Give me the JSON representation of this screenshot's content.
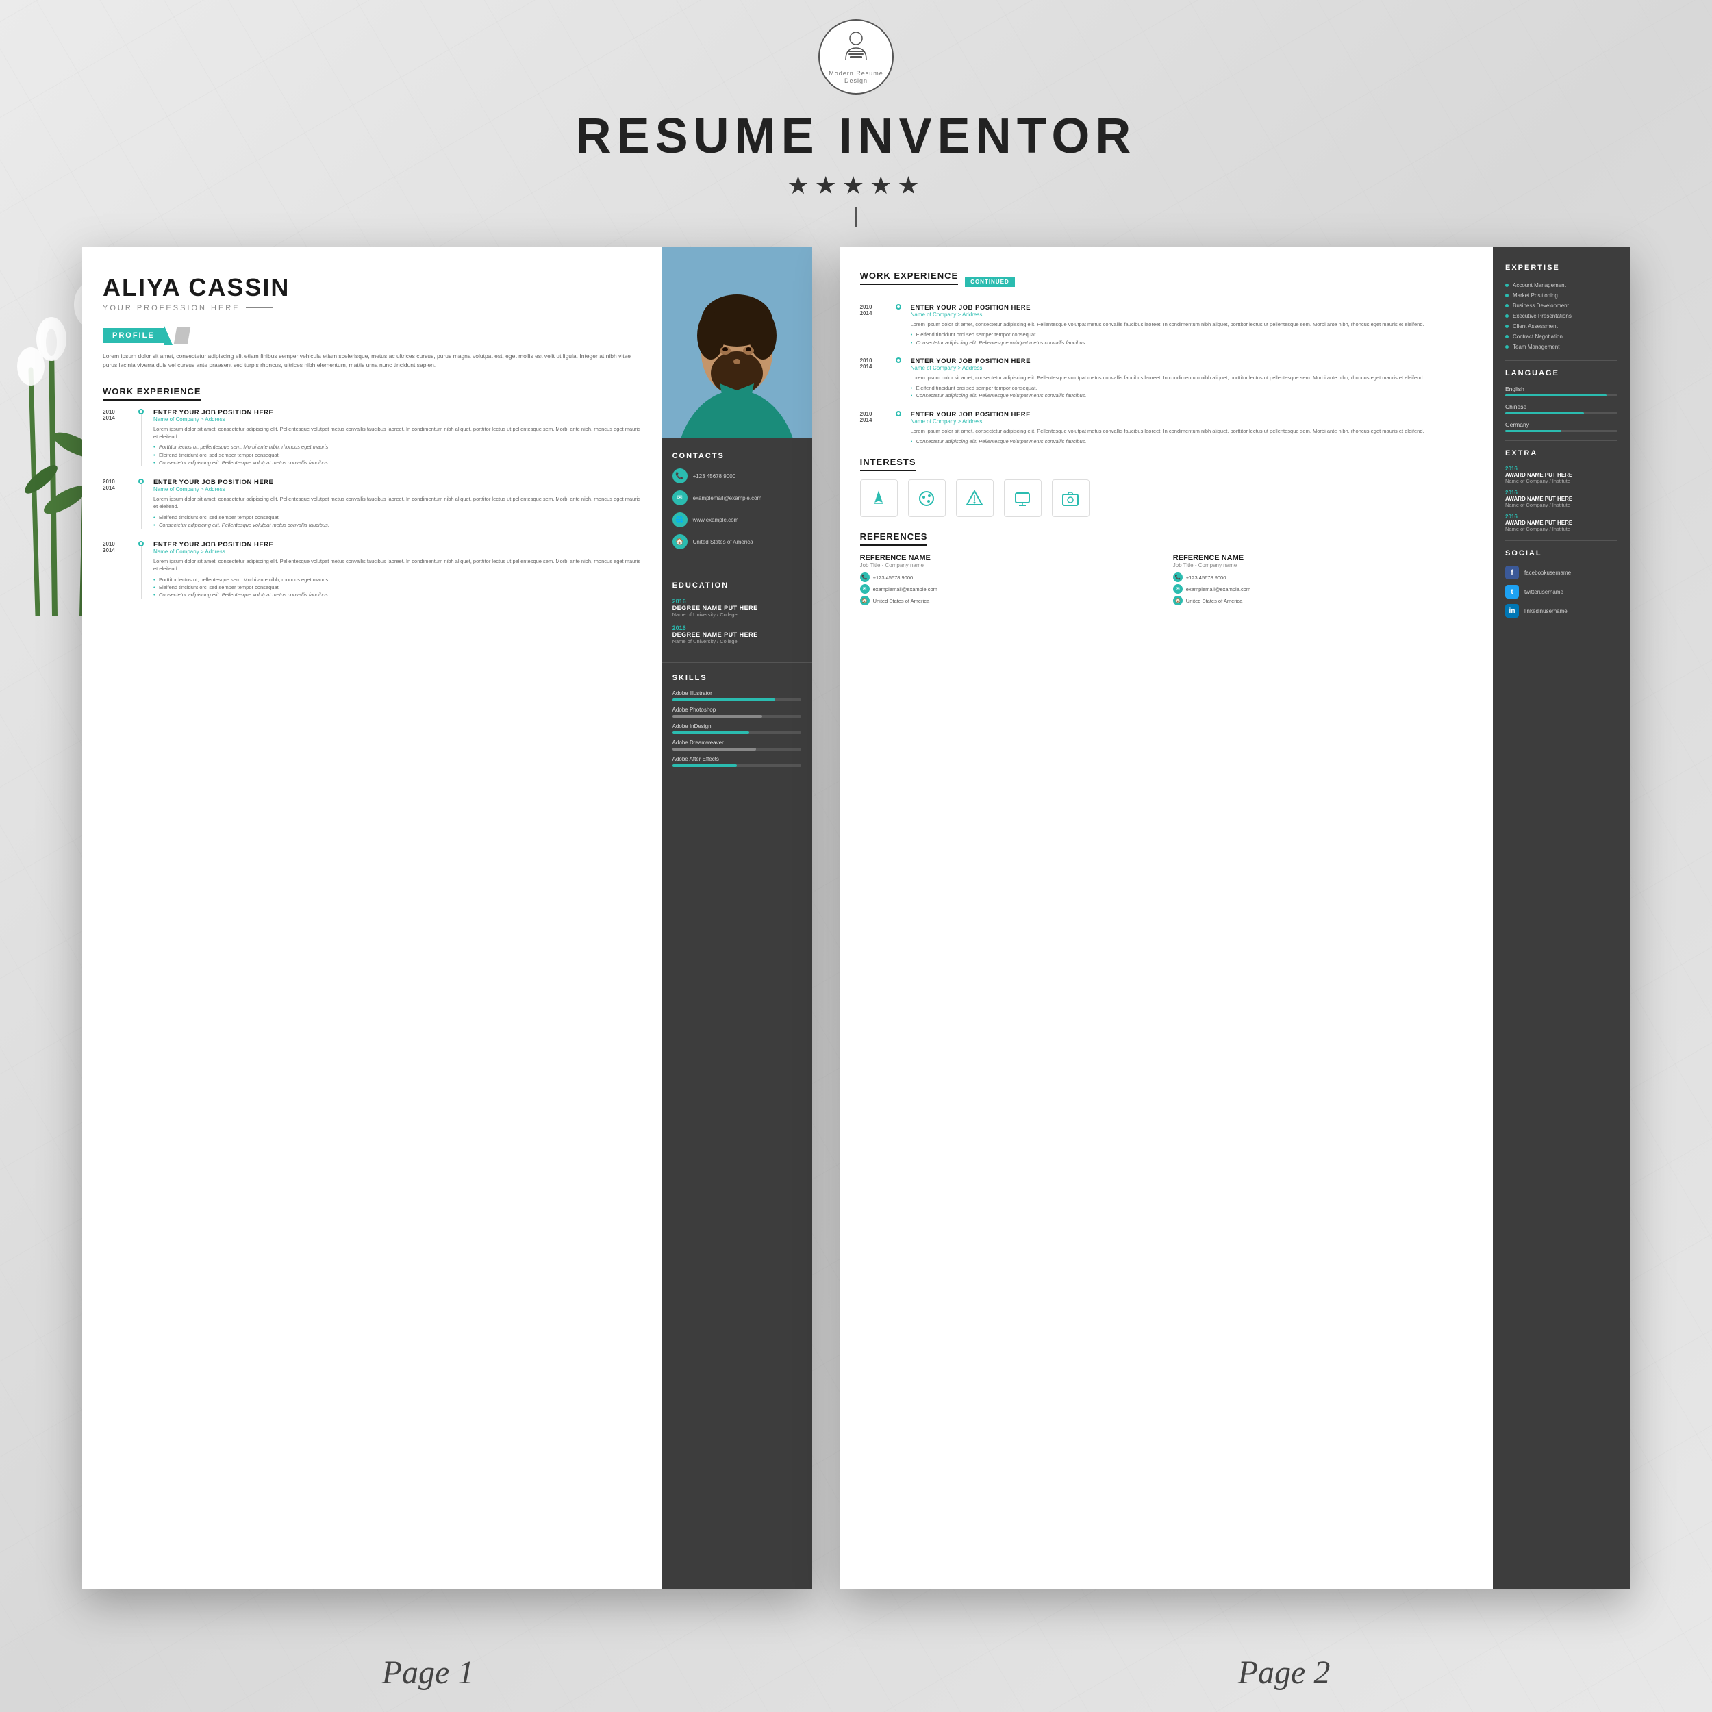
{
  "app": {
    "title": "Resume Inventor",
    "stars": "★★★★★",
    "logo_text": "Modern Resume Design",
    "page1_label": "Page 1",
    "page2_label": "Page 2"
  },
  "resume": {
    "name": "ALIYA CASSIN",
    "profession": "YOUR PROFESSION HERE",
    "profile": {
      "section_title": "PROFILE",
      "text": "Lorem ipsum dolor sit amet, consectetur adipiscing elit etiam finibus semper vehicula etiam scelerisque, metus ac ultrices cursus, purus magna volutpat est, eget mollis est velit ut ligula. Integer at nibh vitae purus lacinia viverra duis vel cursus ante praesent sed turpis rhoncus, ultrices nibh elementum, mattis urna nunc tincidunt sapien."
    },
    "work_experience": {
      "section_title": "WORK EXPERIENCE",
      "entries": [
        {
          "year_start": "2010",
          "year_end": "2014",
          "position": "ENTER YOUR JOB POSITION HERE",
          "company": "Name of Company > Address",
          "desc": "Lorem ipsum dolor sit amet, consectetur adipiscing elit. Pellentesque volutpat metus convallis faucibus laoreet. In condimentum nibh aliquet, porttitor lectus ut pellentesque sem. Morbi ante nibh, rhoncus eget mauris et eleifend.",
          "bullets": [
            "Porttitor lectus ut, pellentesque sem. Morbi ante nibh, rhoncus eget mauris",
            "Eleifend tincidunt orci sed semper tempor consequat.",
            "Consectetur adipiscing elit. Pellentesque volutpat metus convallis faucibus."
          ]
        },
        {
          "year_start": "2010",
          "year_end": "2014",
          "position": "ENTER YOUR JOB POSITION HERE",
          "company": "Name of Company > Address",
          "desc": "Lorem ipsum dolor sit amet, consectetur adipiscing elit. Pellentesque volutpat metus convallis faucibus laoreet. In condimentum nibh aliquet, porttitor lectus ut pellentesque sem. Morbi ante nibh, rhoncus eget mauris et eleifend.",
          "bullets": [
            "Eleifend tincidunt orci sed semper tempor consequat.",
            "Consectetur adipiscing elit. Pellentesque volutpat metus convallis faucibus."
          ]
        },
        {
          "year_start": "2010",
          "year_end": "2014",
          "position": "ENTER YOUR JOB POSITION HERE",
          "company": "Name of Company > Address",
          "desc": "Lorem ipsum dolor sit amet, consectetur adipiscing elit. Pellentesque volutpat metus convallis faucibus laoreet. In condimentum nibh aliquet, porttitor lectus ut pellentesque sem. Morbi ante nibh, rhoncus eget mauris et eleifend.",
          "bullets": [
            "Porttitor lectus ut, pellentesque sem. Morbi ante nibh, rhoncus eget mauris",
            "Eleifend tincidunt orci sed semper tempor consequat.",
            "Consectetur adipiscing elit. Pellentesque volutpat metus convallis faucibus."
          ]
        }
      ]
    },
    "contacts": {
      "section_title": "CONTACTS",
      "phone": "+123 45678 9000",
      "email": "examplemail@example.com",
      "website": "www.example.com",
      "address": "United States of America"
    },
    "education": {
      "section_title": "EDUCATION",
      "entries": [
        {
          "year": "2016",
          "degree": "DEGREE NAME PUT HERE",
          "school": "Name of University / College"
        },
        {
          "year": "2016",
          "degree": "DEGREE NAME PUT HERE",
          "school": "Name of University / College"
        }
      ]
    },
    "skills": {
      "section_title": "SKILLS",
      "items": [
        {
          "name": "Adobe Illustrator",
          "level": 80,
          "type": "teal"
        },
        {
          "name": "Adobe Photoshop",
          "level": 70,
          "type": "light"
        },
        {
          "name": "Adobe InDesign",
          "level": 60,
          "type": "teal"
        },
        {
          "name": "Adobe Dreamweaver",
          "level": 65,
          "type": "light"
        },
        {
          "name": "Adobe After Effects",
          "level": 50,
          "type": "teal"
        }
      ]
    },
    "page2": {
      "work_experience_continued": {
        "section_title": "WORK EXPERIENCE",
        "continued_badge": "CONTINUED",
        "entries": [
          {
            "year_start": "2010",
            "year_end": "2014",
            "position": "ENTER YOUR JOB POSITION HERE",
            "company": "Name of Company > Address",
            "desc": "Lorem ipsum dolor sit amet, consectetur adipiscing elit. Pellentesque volutpat metus convallis faucibus laoreet. In condimentum nibh aliquet, porttitor lectus ut pellentesque sem. Morbi ante nibh, rhoncus eget mauris et eleifend.",
            "bullets": [
              "Eleifend tincidunt orci sed semper tempor consequat.",
              "Consectetur adipiscing elit. Pellentesque volutpat metus convallis faucibus."
            ]
          },
          {
            "year_start": "2010",
            "year_end": "2014",
            "position": "ENTER YOUR JOB POSITION HERE",
            "company": "Name of Company > Address",
            "desc": "Lorem ipsum dolor sit amet, consectetur adipiscing elit. Pellentesque volutpat metus convallis faucibus laoreet. In condimentum nibh aliquet, porttitor lectus ut pellentesque sem. Morbi ante nibh, rhoncus eget mauris et eleifend.",
            "bullets": [
              "Eleifend tincidunt orci sed semper tempor consequat.",
              "Consectetur adipiscing elit. Pellentesque volutpat metus convallis faucibus."
            ]
          },
          {
            "year_start": "2010",
            "year_end": "2014",
            "position": "ENTER YOUR JOB POSITION HERE",
            "company": "Name of Company > Address",
            "desc": "Lorem ipsum dolor sit amet, consectetur adipiscing elit. Pellentesque volutpat metus convallis faucibus laoreet. In condimentum nibh aliquet, porttitor lectus ut pellentesque sem. Morbi ante nibh, rhoncus eget mauris et eleifend.",
            "bullets": [
              "Consectetur adipiscing elit. Pellentesque volutpat metus convallis faucibus."
            ]
          }
        ]
      },
      "interests": {
        "section_title": "INTERESTS",
        "icons": [
          "✈",
          "🎨",
          "🚀",
          "💻",
          "📷"
        ]
      },
      "references": {
        "section_title": "REFERENCES",
        "refs": [
          {
            "name": "REFERENCE NAME",
            "title": "Job Title - Company name",
            "phone": "+123 45678 9000",
            "email": "examplemail@example.com",
            "address": "United States of America"
          },
          {
            "name": "REFERENCE NAME",
            "title": "Job Title - Company name",
            "phone": "+123 45678 9000",
            "email": "examplemail@example.com",
            "address": "United States of America"
          }
        ]
      }
    },
    "expertise": {
      "section_title": "EXPERTISE",
      "items": [
        "Account Management",
        "Market Positioning",
        "Business Development",
        "Executive Presentations",
        "Client Assessment",
        "Contract Negotiation",
        "Team Management"
      ]
    },
    "language": {
      "section_title": "LANGUAGE",
      "items": [
        {
          "name": "English",
          "level": 90
        },
        {
          "name": "Chinese",
          "level": 70
        },
        {
          "name": "Germany",
          "level": 50
        }
      ]
    },
    "extra": {
      "section_title": "EXTRA",
      "items": [
        {
          "year": "2016",
          "award": "AWARD NAME PUT HERE",
          "company": "Name of Company / Institute"
        },
        {
          "year": "2016",
          "award": "AWARD NAME PUT HERE",
          "company": "Name of Company / Institute"
        },
        {
          "year": "2016",
          "award": "AWARD NAME PUT HERE",
          "company": "Name of Company / Institute"
        }
      ]
    },
    "social": {
      "section_title": "SOCIAL",
      "items": [
        {
          "platform": "facebook",
          "username": "facebookusername",
          "icon": "f"
        },
        {
          "platform": "twitter",
          "username": "twitterusername",
          "icon": "t"
        },
        {
          "platform": "linkedin",
          "username": "linkedinusername",
          "icon": "in"
        }
      ]
    }
  }
}
